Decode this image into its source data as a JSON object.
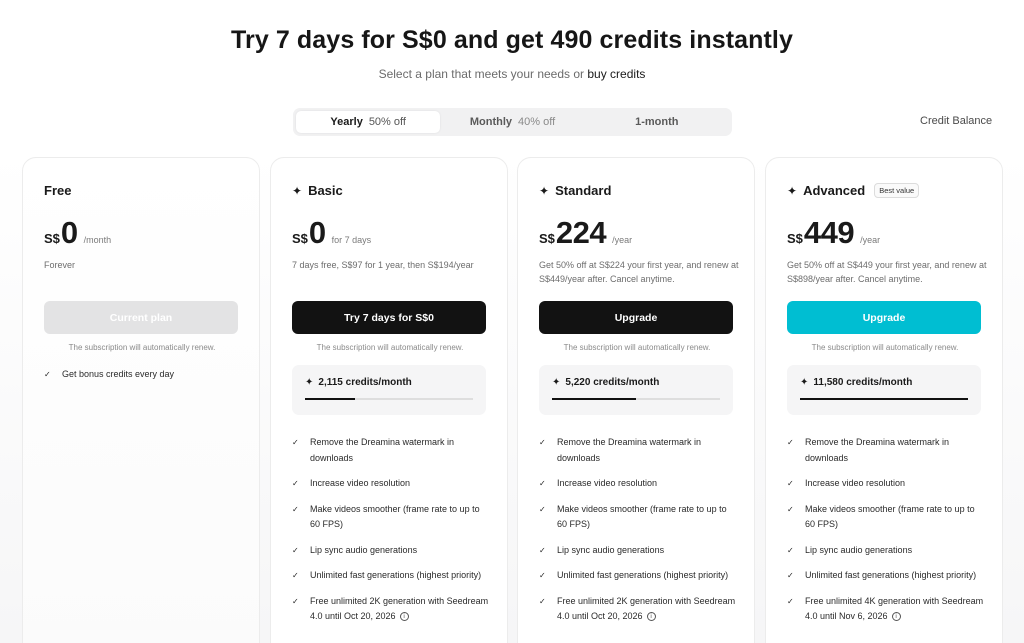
{
  "header": {
    "title": "Try 7 days for S$0 and get 490 credits instantly",
    "subtitle_prefix": "Select a plan that meets your needs or",
    "subtitle_link": "buy credits"
  },
  "billing_tabs": [
    {
      "label": "Yearly",
      "discount": "50% off",
      "active": true
    },
    {
      "label": "Monthly",
      "discount": "40% off",
      "active": false
    },
    {
      "label": "1-month",
      "discount": "",
      "active": false
    }
  ],
  "credit_balance_link": "Credit Balance",
  "check_icon": "✓",
  "sparkle_icon": "✦",
  "plans": [
    {
      "name": "Free",
      "currency": "S$",
      "amount": "0",
      "period": "/month",
      "note": "Forever",
      "cta": "Current plan",
      "renew_note": "The subscription will automatically renew.",
      "features": [
        "Get bonus credits every day"
      ]
    },
    {
      "name": "Basic",
      "currency": "S$",
      "amount": "0",
      "period": "for 7 days",
      "note": "7 days free, S$97 for 1 year, then S$194/year",
      "cta": "Try 7 days for S$0",
      "renew_note": "The subscription will automatically renew.",
      "credits": "2,115  credits/month",
      "credits_fill": 0.3,
      "features": [
        "Remove the Dreamina watermark in downloads",
        "Increase video resolution",
        "Make videos smoother (frame rate to up to 60 FPS)",
        "Lip sync audio generations",
        "Unlimited fast generations (highest priority)",
        "Free unlimited 2K generation with Seedream 4.0 until Oct 20, 2026"
      ]
    },
    {
      "name": "Standard",
      "currency": "S$",
      "amount": "224",
      "period": "/year",
      "note": "Get 50% off at S$224 your first year, and renew at S$449/year after. Cancel anytime.",
      "cta": "Upgrade",
      "renew_note": "The subscription will automatically renew.",
      "credits": "5,220  credits/month",
      "credits_fill": 0.5,
      "features": [
        "Remove the Dreamina watermark in downloads",
        "Increase video resolution",
        "Make videos smoother (frame rate to up to 60 FPS)",
        "Lip sync audio generations",
        "Unlimited fast generations (highest priority)",
        "Free unlimited 2K generation with Seedream 4.0 until Oct 20, 2026"
      ]
    },
    {
      "name": "Advanced",
      "badge": "Best value",
      "currency": "S$",
      "amount": "449",
      "period": "/year",
      "note": "Get 50% off at S$449 your first year, and renew at S$898/year after. Cancel anytime.",
      "cta": "Upgrade",
      "renew_note": "The subscription will automatically renew.",
      "credits": "11,580  credits/month",
      "credits_fill": 1.0,
      "features": [
        "Remove the Dreamina watermark in downloads",
        "Increase video resolution",
        "Make videos smoother (frame rate to up to 60 FPS)",
        "Lip sync audio generations",
        "Unlimited fast generations (highest priority)",
        "Free unlimited 4K generation with Seedream 4.0 until Nov 6, 2026"
      ]
    }
  ],
  "colors": {
    "primary_dark": "#121212",
    "accent_teal": "#00bed2",
    "disabled": "#e3e3e4"
  }
}
